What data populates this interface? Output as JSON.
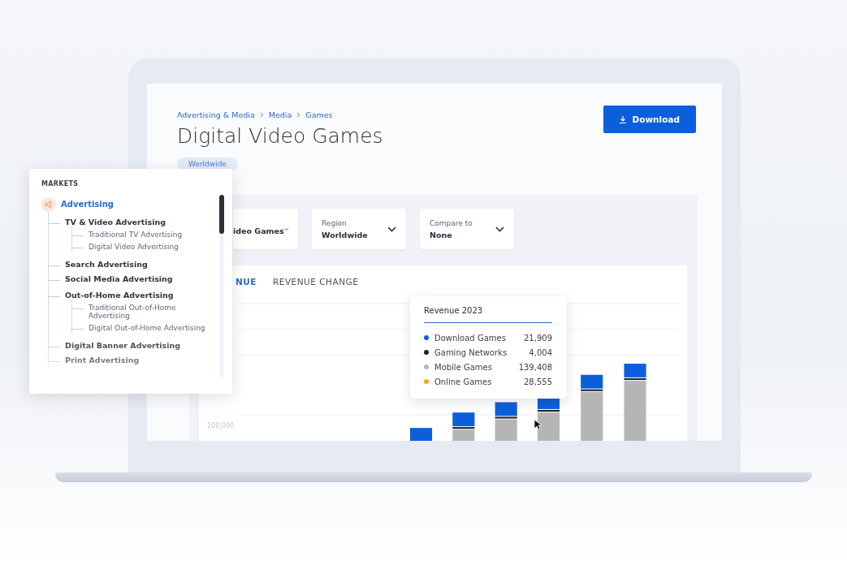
{
  "breadcrumb": [
    {
      "label": "Advertising & Media"
    },
    {
      "label": "Media"
    },
    {
      "label": "Games"
    }
  ],
  "title": "Digital Video Games",
  "region_chip": "Worldwide",
  "download_button": "Download",
  "filters": [
    {
      "value": "ideo Games"
    },
    {
      "label": "Region",
      "value": "Worldwide"
    },
    {
      "label": "Compare to",
      "value": "None"
    }
  ],
  "chart_tabs": [
    {
      "label": "NUE",
      "selected": true
    },
    {
      "label": "REVENUE CHANGE",
      "selected": false
    }
  ],
  "chart_axis_label": "100,000",
  "tooltip": {
    "title": "Revenue 2023",
    "items": [
      {
        "name": "Download Games",
        "value": "21,909",
        "color": "#0b5fdc"
      },
      {
        "name": "Gaming Networks",
        "value": "4,004",
        "color": "#1b2433"
      },
      {
        "name": "Mobile Games",
        "value": "139,408",
        "color": "#b5b5b8"
      },
      {
        "name": "Online Games",
        "value": "28,555",
        "color": "#f5a623"
      }
    ]
  },
  "markets": {
    "heading": "MARKETS",
    "items": [
      {
        "label": "Advertising",
        "selected": true,
        "children": [
          {
            "label": "TV & Video Advertising",
            "selected": false,
            "children": [
              {
                "label": "Traditional TV Advertising",
                "selected": false
              },
              {
                "label": "Digital Video Advertising",
                "selected": false
              }
            ]
          },
          {
            "label": "Search Advertising",
            "selected": false
          },
          {
            "label": "Social Media Advertising",
            "selected": false
          },
          {
            "label": "Out-of-Home Advertising",
            "selected": false,
            "children": [
              {
                "label": "Traditional Out-of-Home Advertising",
                "selected": false
              },
              {
                "label": "Digital Out-of-Home Advertising",
                "selected": false
              }
            ]
          },
          {
            "label": "Digital Banner Advertising",
            "selected": false
          },
          {
            "label": "Print Advertising",
            "selected": false
          }
        ]
      }
    ]
  }
}
